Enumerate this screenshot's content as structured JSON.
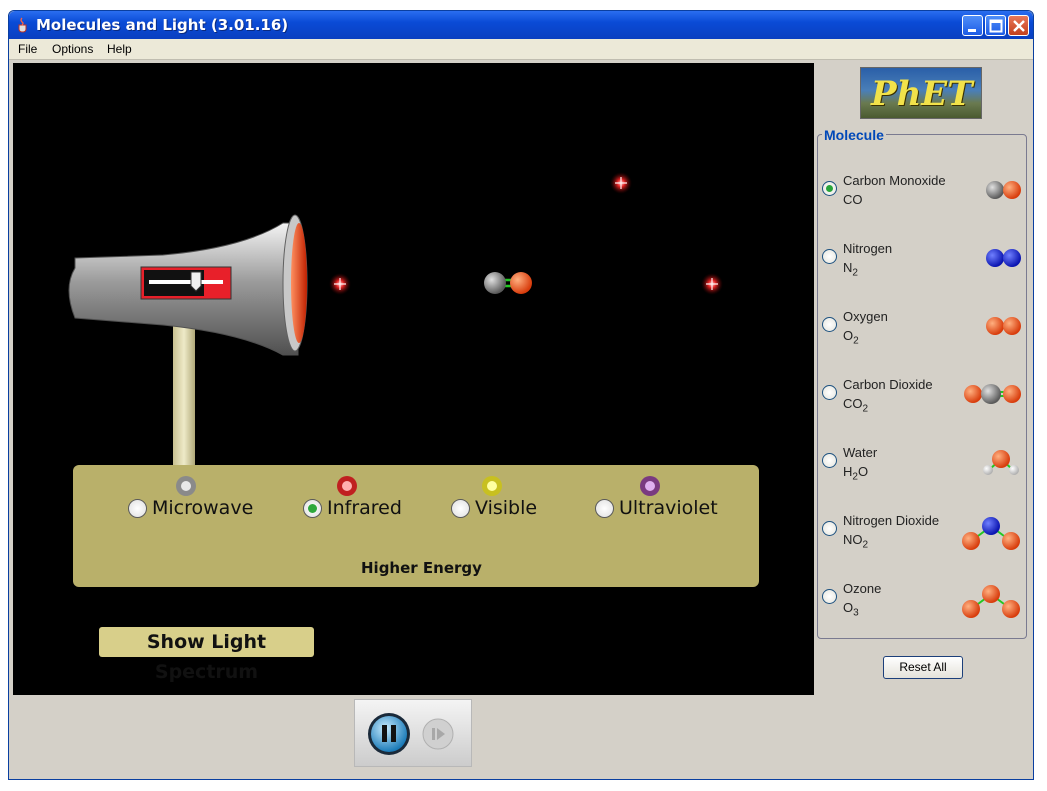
{
  "window": {
    "title": "Molecules and Light (3.01.16)"
  },
  "menu": {
    "items": [
      "File",
      "Options",
      "Help"
    ]
  },
  "logo": {
    "text": "PhET"
  },
  "molecule_panel": {
    "title": "Molecule",
    "molecules": [
      {
        "name": "Carbon Monoxide",
        "formula": "CO",
        "formula_base": "CO",
        "formula_sub": "",
        "selected": true
      },
      {
        "name": "Nitrogen",
        "formula": "N2",
        "formula_base": "N",
        "formula_sub": "2",
        "selected": false
      },
      {
        "name": "Oxygen",
        "formula": "O2",
        "formula_base": "O",
        "formula_sub": "2",
        "selected": false
      },
      {
        "name": "Carbon Dioxide",
        "formula": "CO2",
        "formula_base": "CO",
        "formula_sub": "2",
        "selected": false
      },
      {
        "name": "Water",
        "formula": "H2O",
        "formula_base": "H",
        "formula_sub": "2",
        "formula_tail": "O",
        "selected": false
      },
      {
        "name": "Nitrogen Dioxide",
        "formula": "NO2",
        "formula_base": "NO",
        "formula_sub": "2",
        "selected": false
      },
      {
        "name": "Ozone",
        "formula": "O3",
        "formula_base": "O",
        "formula_sub": "3",
        "selected": false
      }
    ]
  },
  "reset_button": "Reset All",
  "photon_source": {
    "bands": [
      {
        "label": "Microwave",
        "selected": false
      },
      {
        "label": "Infrared",
        "selected": true
      },
      {
        "label": "Visible",
        "selected": false
      },
      {
        "label": "Ultraviolet",
        "selected": false
      }
    ],
    "energy_label": "Higher Energy"
  },
  "spectrum_button": "Show Light Spectrum",
  "colors": {
    "carbon": "#808080",
    "oxygen": "#e8501a",
    "nitrogen": "#1020d0",
    "hydrogen": "#e8e8e8",
    "bond": "#22c822",
    "panel": "#b9b06a",
    "accent_title": "#0048b8"
  },
  "icons": [
    "java-cup-icon",
    "minimize-icon",
    "maximize-icon",
    "close-icon",
    "pause-icon",
    "step-icon"
  ]
}
